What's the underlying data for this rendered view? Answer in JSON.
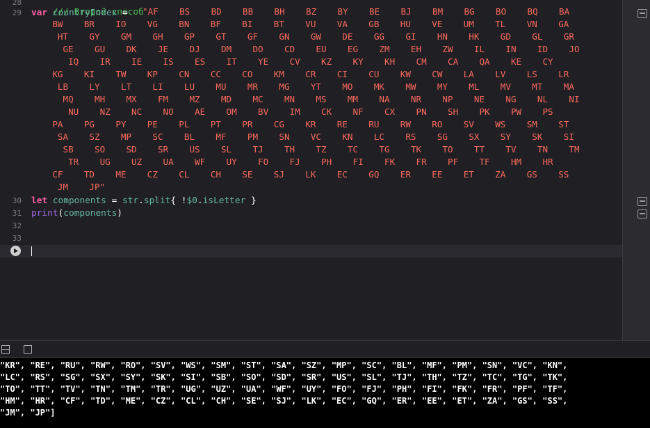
{
  "editor": {
    "line_numbers": [
      "28",
      "29",
      "30",
      "31",
      "32",
      "33"
    ],
    "line28_comment": "/// Второй способ",
    "line29": {
      "keyword": "var",
      "name": "countryIndex",
      "op": " = ",
      "string_rows": [
        "\"AF    BS    BD    BB    BH    BZ    BY    BE    BJ    BM    BG    BO    BQ    BA",
        "    BW    BR    IO    VG    BN    BF    BI    BT    VU    VA    GB    HU    VE    UM    TL    VN    GA",
        "     HT    GY    GM    GH    GP    GT    GF    GN    GW    DE    GG    GI    HN    HK    GD    GL    GR",
        "      GE    GU    DK    JE    DJ    DM    DO    CD    EU    EG    ZM    EH    ZW    IL    IN    ID    JO",
        "       IQ    IR    IE    IS    ES    IT    YE    CV    KZ    KY    KH    CM    CA    QA    KE    CY",
        "    KG    KI    TW    KP    CN    CC    CO    KM    CR    CI    CU    KW    CW    LA    LV    LS    LR",
        "     LB    LY    LT    LI    LU    MU    MR    MG    YT    MO    MK    MW    MY    ML    MV    MT    MA",
        "      MQ    MH    MX    FM    MZ    MD    MC    MN    MS    MM    NA    NR    NP    NE    NG    NL    NI",
        "       NU    NZ    NC    NO    AE    OM    BV    IM    CK    NF    CX    PN    SH    PK    PW    PS",
        "    PA    PG    PY    PE    PL    PT    PR    CG    KR    RE    RU    RW    RO    SV    WS    SM    ST",
        "     SA    SZ    MP    SC    BL    MF    PM    SN    VC    KN    LC    RS    SG    SX    SY    SK    SI",
        "      SB    SO    SD    SR    US    SL    TJ    TH    TZ    TC    TG    TK    TO    TT    TV    TN    TM",
        "       TR    UG    UZ    UA    WF    UY    FO    FJ    PH    FI    FK    FR    PF    TF    HM    HR",
        "    CF    TD    ME    CZ    CL    CH    SE    SJ    LK    EC    GQ    ER    EE    ET    ZA    GS    SS",
        "     JM    JP\""
      ]
    },
    "line30": {
      "keyword": "let",
      "name": "components",
      "op1": " = ",
      "recv": "str",
      "dot": ".",
      "method": "split",
      "open": "{ !",
      "param": "$0",
      "dot2": ".",
      "prop": "isLetter",
      "close": " }"
    },
    "line31": {
      "fn": "print",
      "open": "(",
      "arg": "components",
      "close": ")"
    }
  },
  "console": {
    "rows": [
      "\"KR\", \"RE\", \"RU\", \"RW\", \"RO\", \"SV\", \"WS\", \"SM\", \"ST\", \"SA\", \"SZ\", \"MP\", \"SC\", \"BL\", \"MF\", \"PM\", \"SN\", \"VC\", \"KN\",",
      "\"LC\", \"RS\", \"SG\", \"SX\", \"SY\", \"SK\", \"SI\", \"SB\", \"SO\", \"SD\", \"SR\", \"US\", \"SL\", \"TJ\", \"TH\", \"TZ\", \"TC\", \"TG\", \"TK\",",
      "\"TO\", \"TT\", \"TV\", \"TN\", \"TM\", \"TR\", \"UG\", \"UZ\", \"UA\", \"WF\", \"UY\", \"FO\", \"FJ\", \"PH\", \"FI\", \"FK\", \"FR\", \"PF\", \"TF\",",
      "\"HM\", \"HR\", \"CF\", \"TD\", \"ME\", \"CZ\", \"CL\", \"CH\", \"SE\", \"SJ\", \"LK\", \"EC\", \"GQ\", \"ER\", \"EE\", \"ET\", \"ZA\", \"GS\", \"SS\",",
      "\"JM\", \"JP\"]"
    ]
  },
  "colors": {
    "string": "#fc6a5d",
    "keyword": "#fc5fa3",
    "identifier": "#67b7a4",
    "function": "#a167e6",
    "background": "#1f1f24",
    "console_bg": "#000000"
  },
  "icons": [
    "run-icon",
    "hide-debug-area-icon",
    "show-console-icon",
    "result-toggle-icon"
  ]
}
